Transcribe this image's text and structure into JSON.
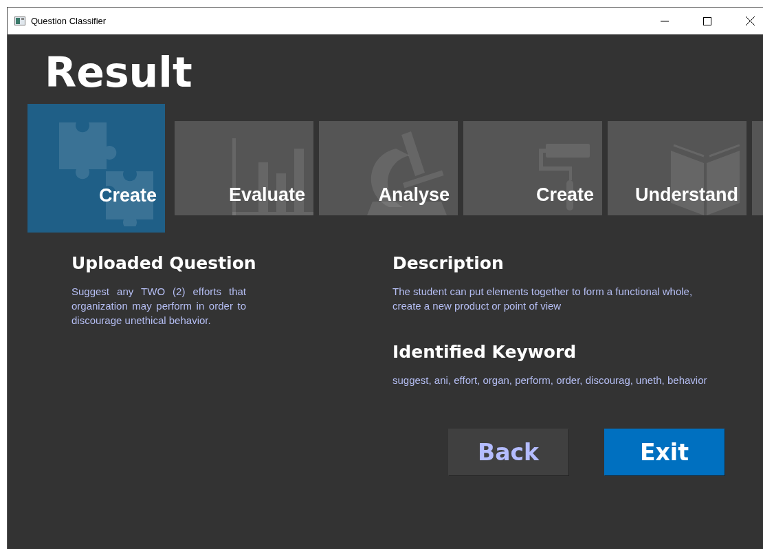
{
  "window": {
    "title": "Question Classifier"
  },
  "heading": "Result",
  "categories": [
    {
      "label": "Create",
      "kind": "puzzle",
      "selected": true
    },
    {
      "label": "Evaluate",
      "kind": "chart",
      "selected": false
    },
    {
      "label": "Analyse",
      "kind": "microscope",
      "selected": false
    },
    {
      "label": "Create",
      "kind": "roller",
      "selected": false
    },
    {
      "label": "Understand",
      "kind": "book",
      "selected": false
    }
  ],
  "uploaded_question": {
    "title": "Uploaded Question",
    "text": "Suggest any TWO (2) efforts that organization may perform in order to discourage unethical behavior."
  },
  "description": {
    "title": "Description",
    "text": "The student can put elements together to form a functional whole, create a new product or point of view"
  },
  "identified_keyword": {
    "title": "Identified Keyword",
    "text": "suggest, ani, effort, organ, perform, order, discourag, uneth, behavior"
  },
  "buttons": [
    {
      "label": "Back",
      "kind": "secondary"
    },
    {
      "label": "Exit",
      "kind": "primary"
    }
  ]
}
